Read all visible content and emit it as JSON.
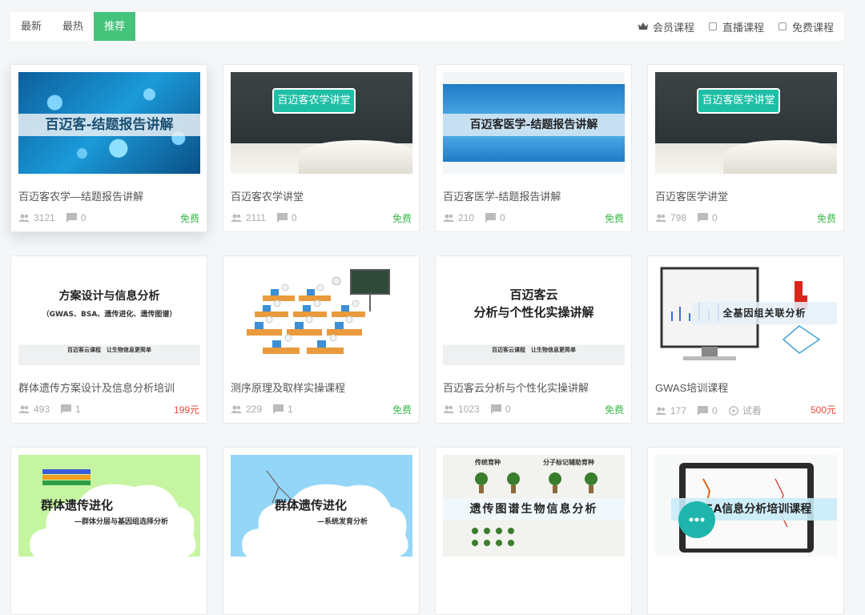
{
  "sort_tabs": [
    {
      "label": "最新",
      "active": false
    },
    {
      "label": "最热",
      "active": false
    },
    {
      "label": "推荐",
      "active": true
    }
  ],
  "filters": {
    "member": "会员课程",
    "live": "直播课程",
    "free": "免费课程"
  },
  "colors": {
    "accent": "#46c37b",
    "free": "#3cb84c",
    "paid": "#e94a3a"
  },
  "courses": [
    {
      "title": "百迈客农学—结题报告讲解",
      "students": "3121",
      "comments": "0",
      "price": "免费",
      "thumb_text": "百迈客-结题报告讲解"
    },
    {
      "title": "百迈客农学讲堂",
      "students": "2111",
      "comments": "0",
      "price": "免费",
      "thumb_text": "百迈客农学讲堂"
    },
    {
      "title": "百迈客医学-结题报告讲解",
      "students": "210",
      "comments": "0",
      "price": "免费",
      "thumb_text": "百迈客医学-结题报告讲解"
    },
    {
      "title": "百迈客医学讲堂",
      "students": "798",
      "comments": "0",
      "price": "免费",
      "thumb_text": "百迈客医学讲堂"
    },
    {
      "title": "群体遗传方案设计及信息分析培训",
      "students": "493",
      "comments": "1",
      "price": "199元",
      "thumb_text": "方案设计与信息分析",
      "thumb_sub": "（GWAS、BSA、遗传进化、遗传图谱）",
      "thumb_foot": "百迈客云课程　让生物信息更简单"
    },
    {
      "title": "测序原理及取样实操课程",
      "students": "229",
      "comments": "1",
      "price": "免费"
    },
    {
      "title": "百迈客云分析与个性化实操讲解",
      "students": "1023",
      "comments": "0",
      "price": "免费",
      "thumb_text": "百迈客云",
      "thumb_sub": "分析与个性化实操讲解",
      "thumb_foot": "百迈客云课程　让生物信息更简单"
    },
    {
      "title": "GWAS培训课程",
      "students": "177",
      "comments": "0",
      "trial": "试看",
      "price": "500元",
      "thumb_text": "全基因组关联分析"
    },
    {
      "thumb_text": "群体遗传进化",
      "thumb_sub": "—群体分层与基因组选择分析"
    },
    {
      "thumb_text": "群体遗传进化",
      "thumb_sub": "—系统发育分析"
    },
    {
      "thumb_text": "遗传图谱生物信息分析",
      "thumb_top1": "传统育种",
      "thumb_top2": "分子标记辅助育种"
    },
    {
      "thumb_text": "BSA信息分析培训课程"
    }
  ],
  "chat_icon": "chat-bubble-icon"
}
